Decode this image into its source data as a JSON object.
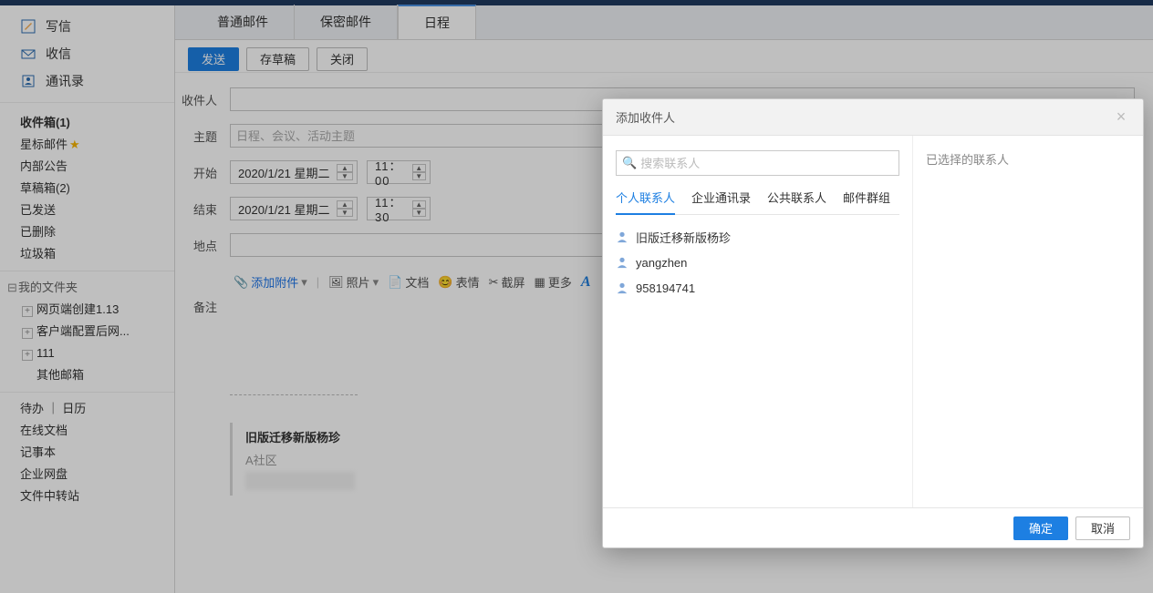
{
  "sidebar": {
    "actions": {
      "compose": "写信",
      "receive": "收信",
      "contacts": "通讯录"
    },
    "nav": [
      {
        "label": "收件箱(1)",
        "bold": true
      },
      {
        "label": "星标邮件",
        "star": true
      },
      {
        "label": "内部公告"
      },
      {
        "label": "草稿箱(2)"
      },
      {
        "label": "已发送"
      },
      {
        "label": "已删除"
      },
      {
        "label": "垃圾箱"
      }
    ],
    "folders_header": "我的文件夹",
    "folders": [
      {
        "label": "网页端创建1.13"
      },
      {
        "label": "客户端配置后网..."
      },
      {
        "label": "111"
      },
      {
        "label": "其他邮箱",
        "noicon": true
      }
    ],
    "links": [
      {
        "label": "待办 ｜ 日历"
      },
      {
        "label": "在线文档"
      },
      {
        "label": "记事本"
      },
      {
        "label": "企业网盘"
      },
      {
        "label": "文件中转站"
      }
    ]
  },
  "tabs": [
    {
      "label": "普通邮件"
    },
    {
      "label": "保密邮件"
    },
    {
      "label": "日程",
      "active": true
    }
  ],
  "toolbar": {
    "send": "发送",
    "draft": "存草稿",
    "close": "关闭"
  },
  "form": {
    "to_label": "收件人",
    "to_value": "",
    "subject_label": "主题",
    "subject_placeholder": "日程、会议、活动主题",
    "start_label": "开始",
    "start_date": "2020/1/21 星期二",
    "start_time": "11： 00",
    "end_label": "结束",
    "end_date": "2020/1/21 星期二",
    "end_time": "11： 30",
    "location_label": "地点",
    "location_value": "",
    "notes_label": "备注"
  },
  "editor_bar": {
    "attach": "添加附件",
    "photo": "照片",
    "doc": "文档",
    "emoji": "表情",
    "shot": "截屏",
    "more": "更多"
  },
  "signature": {
    "name": "旧版迁移新版杨珍",
    "org": "A社区"
  },
  "dialog": {
    "title": "添加收件人",
    "search_placeholder": "搜索联系人",
    "tabs": [
      "个人联系人",
      "企业通讯录",
      "公共联系人",
      "邮件群组"
    ],
    "active_tab_index": 0,
    "contacts": [
      "旧版迁移新版杨珍",
      "yangzhen",
      "958194741"
    ],
    "selected_header": "已选择的联系人",
    "ok": "确定",
    "cancel": "取消"
  }
}
